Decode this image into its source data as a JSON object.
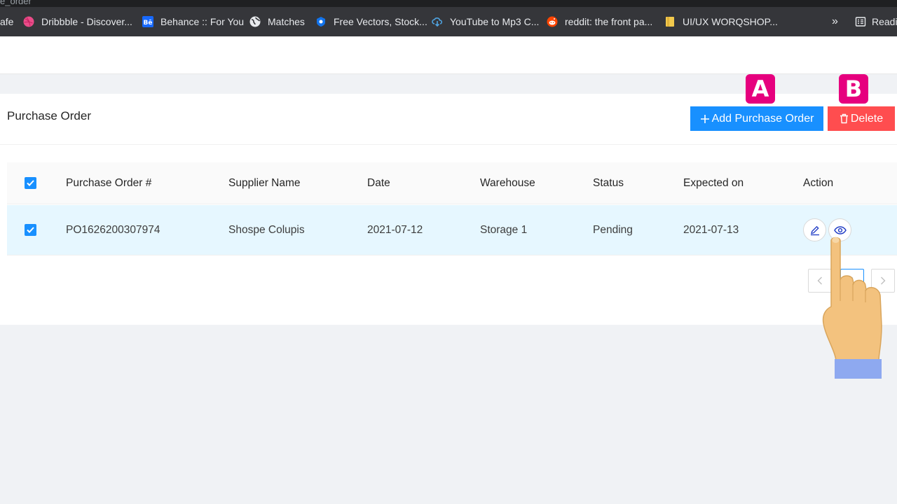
{
  "browser": {
    "url_fragment": "e_order",
    "bookmarks": [
      {
        "label": "afe",
        "icon": "none"
      },
      {
        "label": "Dribbble - Discover...",
        "icon": "dribbble-icon"
      },
      {
        "label": "Behance :: For You",
        "icon": "behance-icon"
      },
      {
        "label": "Matches",
        "icon": "globe-icon"
      },
      {
        "label": "Free Vectors, Stock...",
        "icon": "freepik-icon"
      },
      {
        "label": "YouTube to Mp3 C...",
        "icon": "cloud-download-icon"
      },
      {
        "label": "reddit: the front pa...",
        "icon": "reddit-icon"
      },
      {
        "label": "UI/UX WORQSHOP...",
        "icon": "folder-icon"
      }
    ],
    "more": "»",
    "reading_list": "Readi"
  },
  "card": {
    "title": "Purchase Order",
    "add_button": "Add Purchase Order",
    "delete_button": "Delete"
  },
  "table": {
    "columns": [
      "Purchase Order #",
      "Supplier Name",
      "Date",
      "Warehouse",
      "Status",
      "Expected on",
      "Action"
    ],
    "rows": [
      {
        "po": "PO1626200307974",
        "supplier": "Shospe Colupis",
        "date": "2021-07-12",
        "warehouse": "Storage 1",
        "status": "Pending",
        "expected": "2021-07-13",
        "selected": true
      }
    ]
  },
  "pagination": {
    "current": "1"
  },
  "annotations": {
    "badge_a": "A",
    "badge_b": "B"
  },
  "colors": {
    "primary": "#1890ff",
    "danger": "#ff4d4f",
    "badge": "#e6007e",
    "row_selected": "#e6f7ff"
  }
}
